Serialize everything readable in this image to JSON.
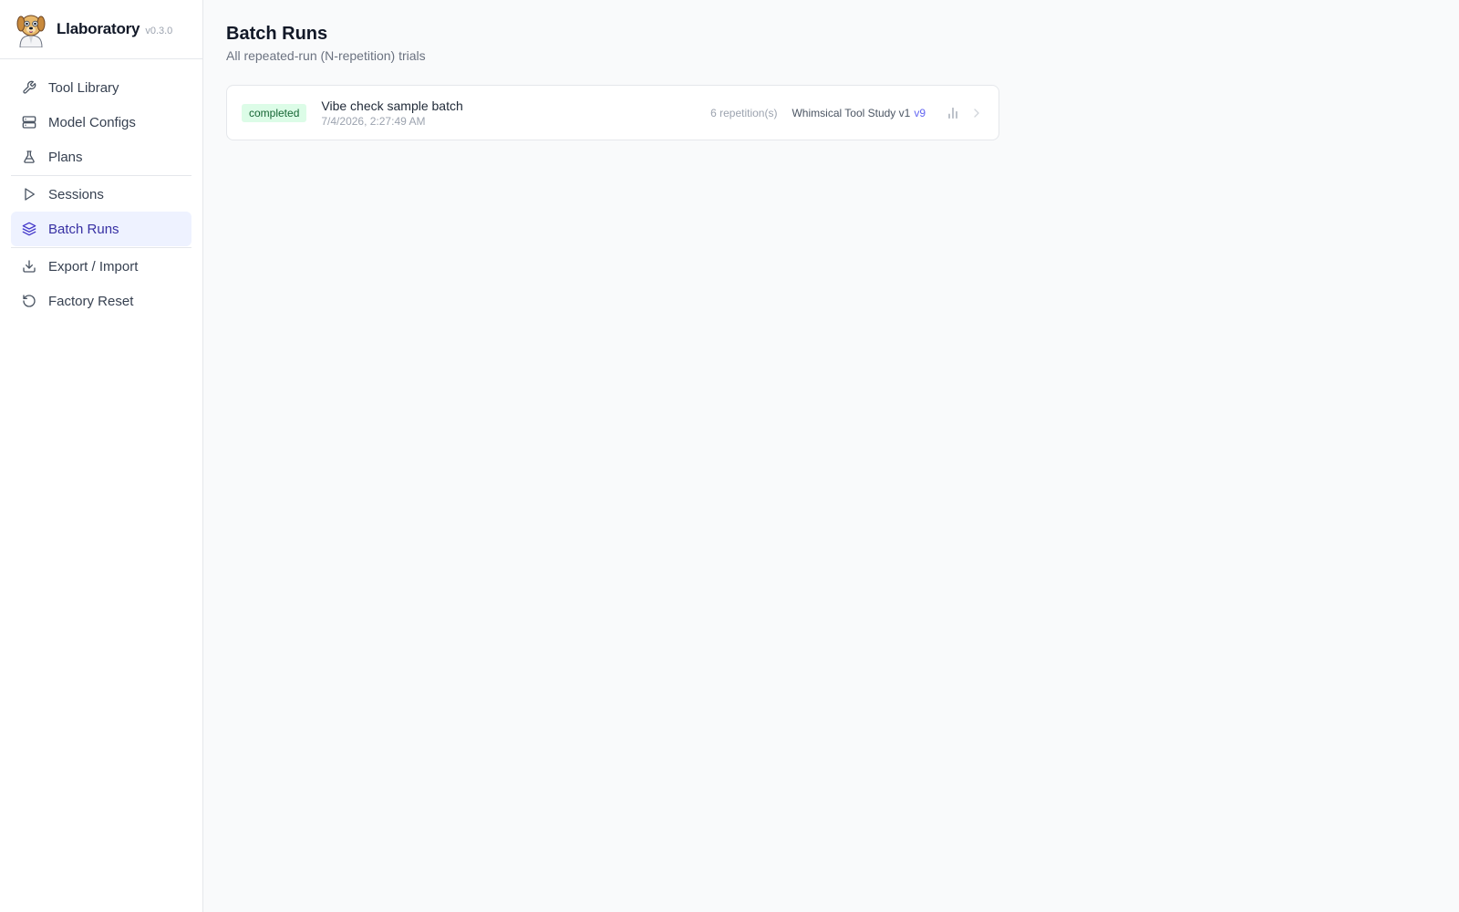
{
  "brand": {
    "name": "Llaboratory",
    "version": "v0.3.0"
  },
  "sidebar": {
    "items": [
      {
        "label": "Tool Library",
        "icon": "wrench-icon"
      },
      {
        "label": "Model Configs",
        "icon": "server-icon"
      },
      {
        "label": "Plans",
        "icon": "flask-icon"
      },
      {
        "label": "Sessions",
        "icon": "play-icon"
      },
      {
        "label": "Batch Runs",
        "icon": "layers-icon",
        "active": true
      },
      {
        "label": "Export / Import",
        "icon": "download-icon"
      },
      {
        "label": "Factory Reset",
        "icon": "rotate-ccw-icon"
      }
    ]
  },
  "page": {
    "title": "Batch Runs",
    "subtitle": "All repeated-run (N-repetition) trials"
  },
  "batch_runs": [
    {
      "status": "completed",
      "name": "Vibe check sample batch",
      "date": "7/4/2026, 2:27:49 AM",
      "repetitions": "6 repetition(s)",
      "plan": "Whimsical Tool Study v1",
      "plan_version": "v9"
    }
  ],
  "colors": {
    "accent": "#4f46e5",
    "active_bg": "#eef2ff",
    "status_completed_bg": "#dcfce7",
    "status_completed_text": "#166534"
  }
}
